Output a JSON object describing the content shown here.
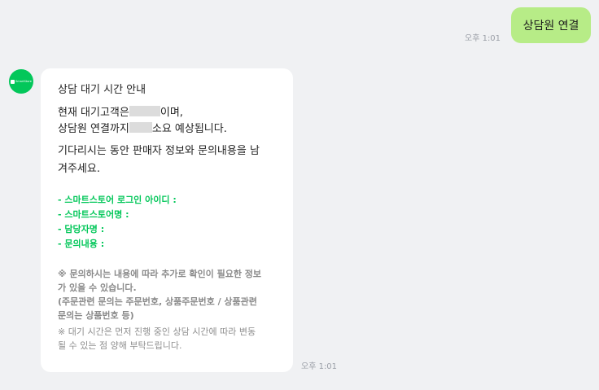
{
  "user_message": {
    "text": "상담원 연결",
    "time": "오후 1:01"
  },
  "bot_message": {
    "time": "오후 1:01",
    "avatar_label": "SmartStore",
    "title": "상담 대기 시간 안내",
    "wait_line_1_prefix": "현재 대기고객은",
    "wait_line_1_suffix": "이며,",
    "wait_line_2_prefix": "상담원 연결까지",
    "wait_line_2_suffix": "소요 예상됩니다.",
    "request_line_1": "기다리시는 동안 판매자 정보와 문의내용을 남",
    "request_line_2": "겨주세요.",
    "fields": [
      "- 스마트스토어 로그인 아이디 :",
      "- 스마트스토어명 :",
      "- 담당자명 :",
      "- 문의내용 :"
    ],
    "note_1_line_1": "※ 문의하시는 내용에 따라 추가로 확인이 필요한 정보",
    "note_1_line_2": "가 있을 수 있습니다.",
    "note_1_line_3": "(주문관련 문의는 주문번호, 상품주문번호 / 상품관련",
    "note_1_line_4": "문의는 상품번호 등)",
    "note_2_line_1": "※ 대기 시간은 먼저 진행 중인 상담 시간에 따라 변동",
    "note_2_line_2": "될 수 있는 점 양해 부탁드립니다."
  },
  "colors": {
    "background": "#f0f1f3",
    "user_bubble": "#b7ec87",
    "bot_bubble": "#ffffff",
    "accent_green": "#03c75a"
  }
}
